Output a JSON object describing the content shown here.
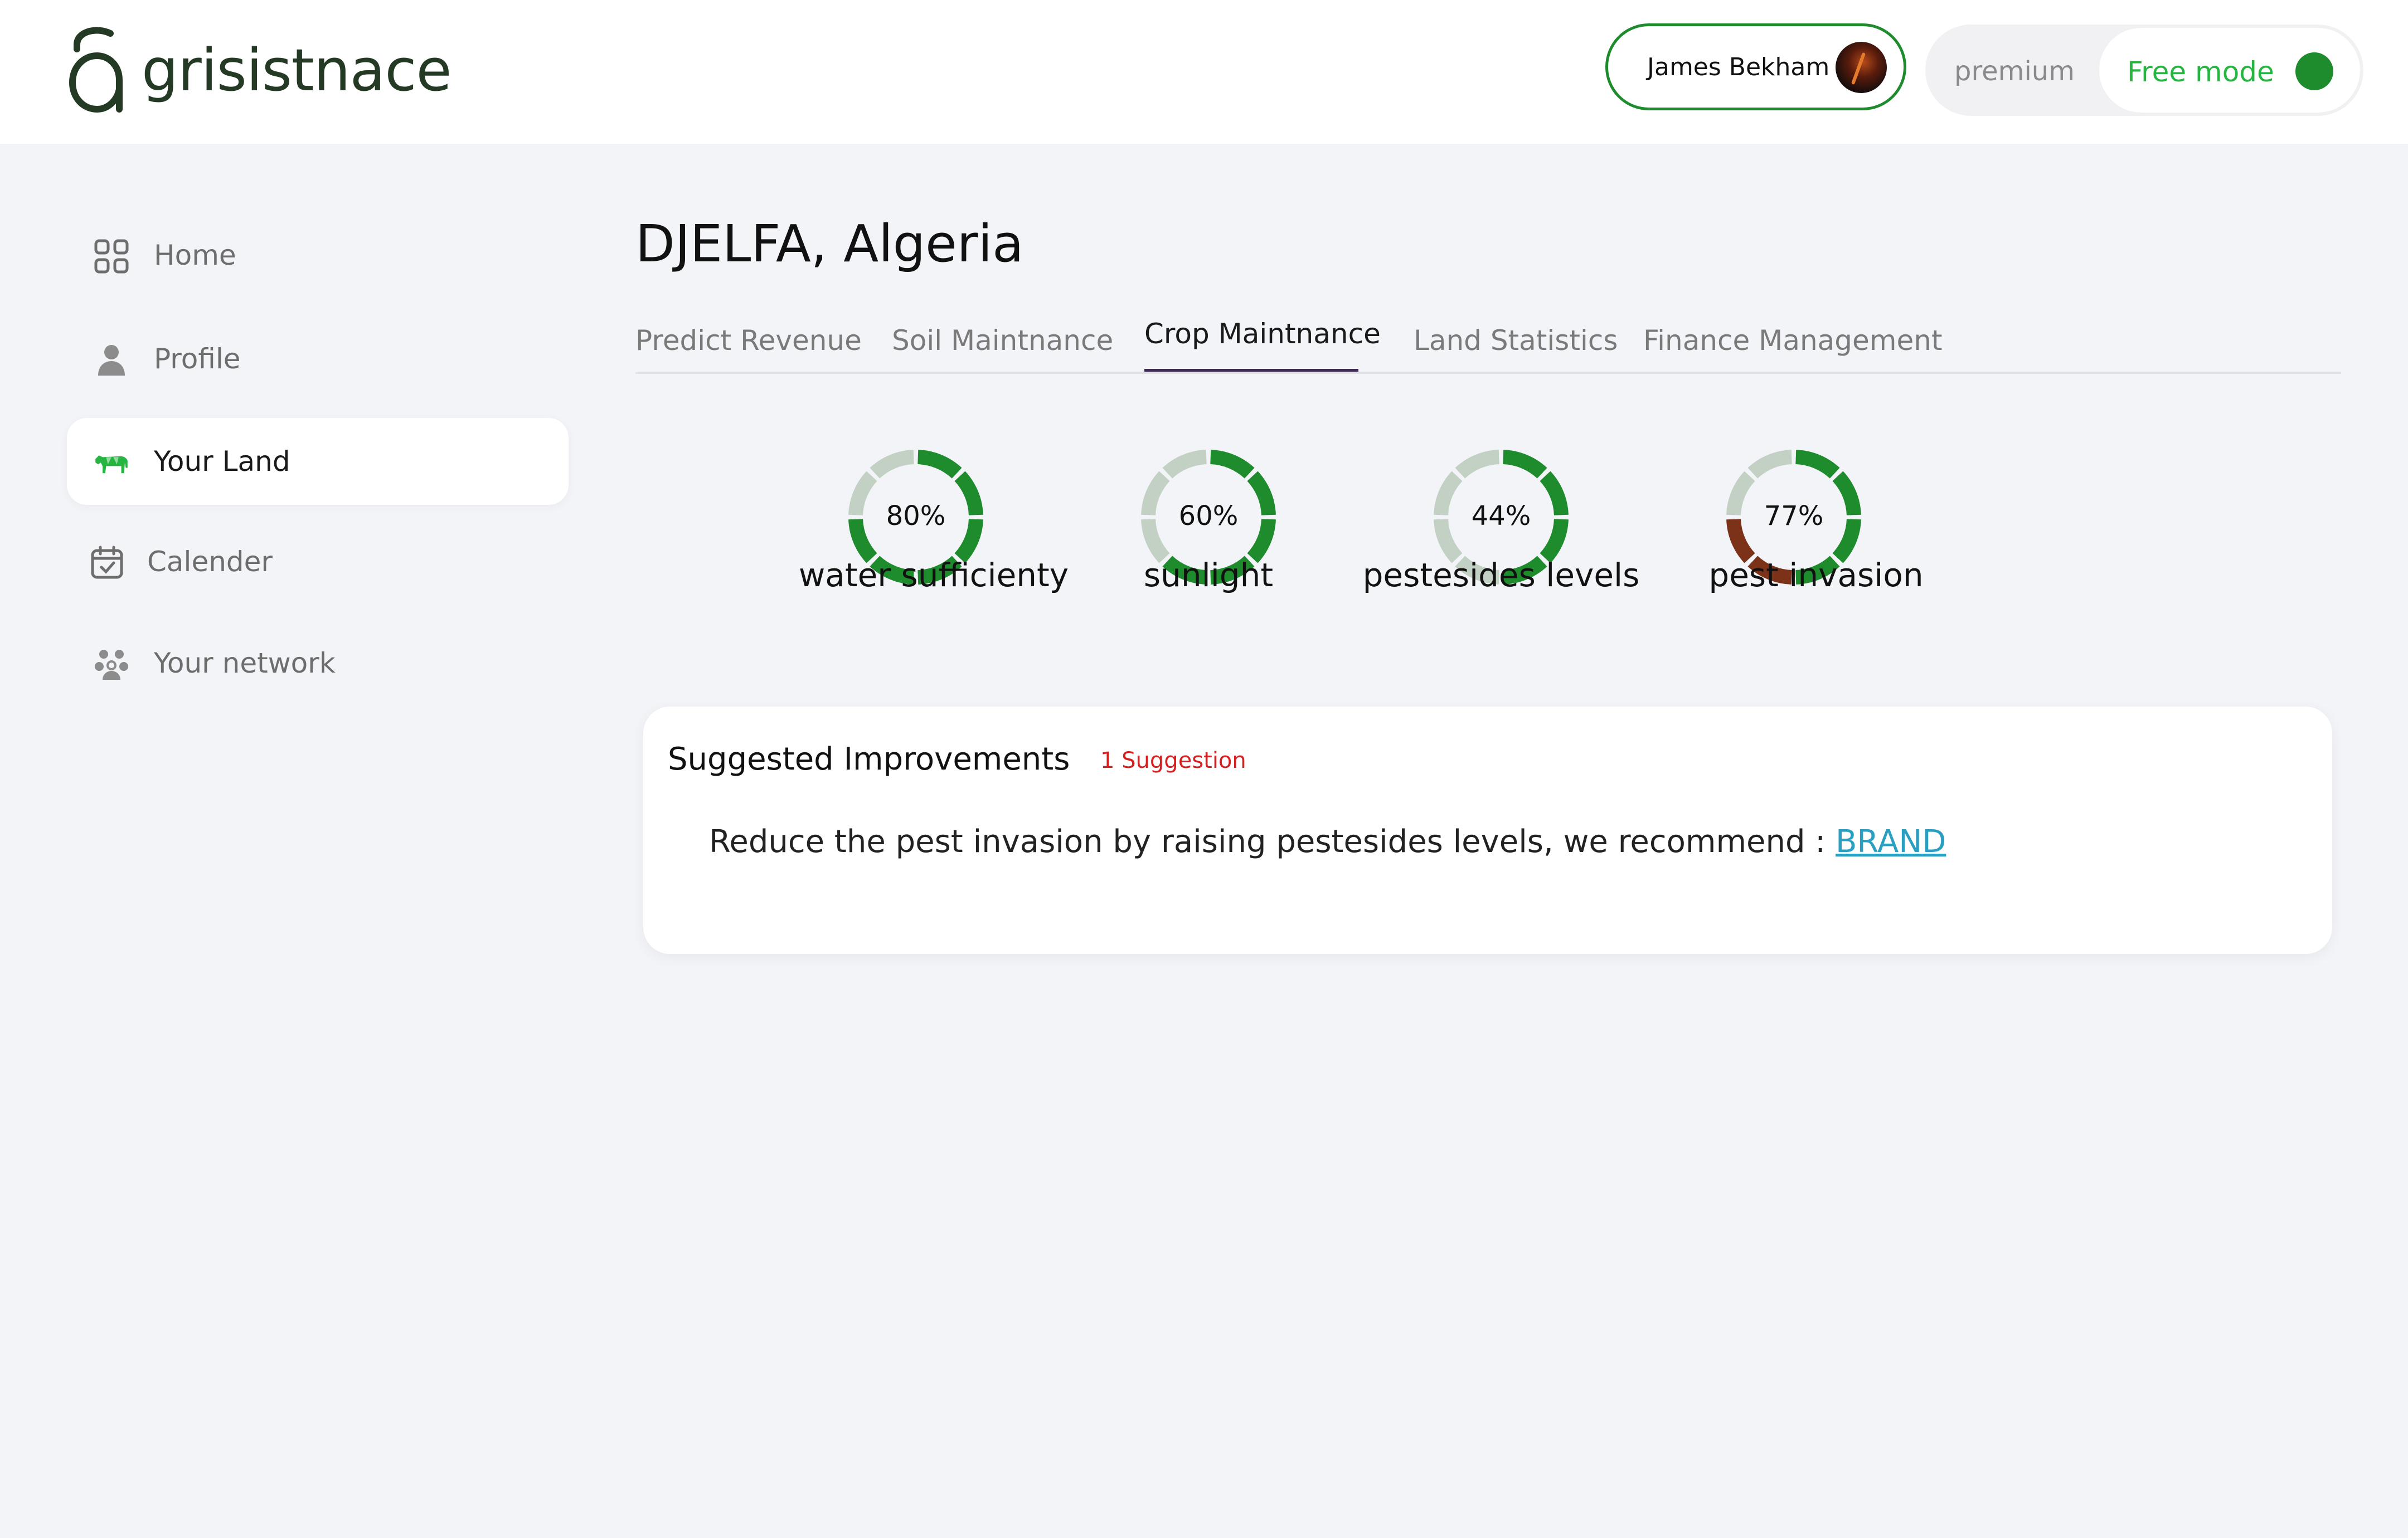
{
  "brand": {
    "name": "grisistnace"
  },
  "header": {
    "user_name": "James Bekham",
    "mode": {
      "premium_label": "premium",
      "free_label": "Free mode"
    }
  },
  "sidebar": {
    "items": [
      {
        "label": "Home",
        "icon": "grid-icon",
        "active": false
      },
      {
        "label": "Profile",
        "icon": "user-icon",
        "active": false
      },
      {
        "label": "Your Land",
        "icon": "cow-icon",
        "active": true
      },
      {
        "label": "Calender",
        "icon": "calendar-icon",
        "active": false
      },
      {
        "label": "Your network",
        "icon": "network-icon",
        "active": false
      }
    ]
  },
  "main": {
    "title": "DJELFA, Algeria",
    "tabs": [
      {
        "label": "Predict Revenue",
        "active": false
      },
      {
        "label": "Soil Maintnance",
        "active": false
      },
      {
        "label": "Crop Maintnance",
        "active": true
      },
      {
        "label": "Land Statistics",
        "active": false
      },
      {
        "label": "Finance Management",
        "active": false
      }
    ],
    "gauges": [
      {
        "value": "80%",
        "label": "water sufficienty",
        "percent": 80,
        "alert": false
      },
      {
        "value": "60%",
        "label": "sunlight",
        "percent": 60,
        "alert": false
      },
      {
        "value": "44%",
        "label": "pestesides levels",
        "percent": 44,
        "alert": false
      },
      {
        "value": "77%",
        "label": "pest invasion",
        "percent": 77,
        "alert": true
      }
    ],
    "suggestions": {
      "title": "Suggested Improvements",
      "count_label": "1 Suggestion",
      "text": "Reduce the pest invasion by raising pestesides levels, we recommend : ",
      "link_label": "BRAND"
    }
  },
  "colors": {
    "accent_green": "#1e8b2c",
    "free_mode_green": "#27b542",
    "gauge_empty": "#c2d1c4",
    "gauge_alert": "#7b3218",
    "link_blue": "#2a9fc2",
    "suggestion_red": "#d81f1f"
  }
}
